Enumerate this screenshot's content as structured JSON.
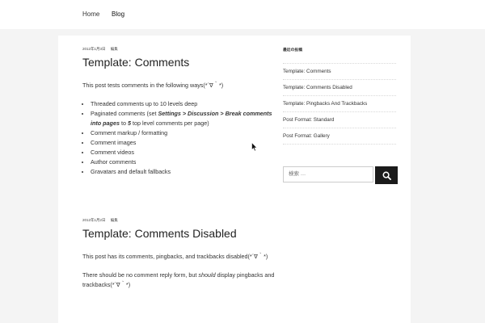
{
  "nav": {
    "home": "Home",
    "blog": "Blog"
  },
  "posts": [
    {
      "date": "2012年1月3日",
      "category": "編集",
      "title": "Template: Comments",
      "intro": "This post tests comments in the following ways(*´∇｀*)",
      "list": [
        "Threaded comments up to 10 levels deep",
        "Paginated comments",
        "Comment markup / formatting",
        "Comment images",
        "Comment videos",
        "Author comments",
        "Gravatars and default fallbacks"
      ],
      "paginated": {
        "pre": " (set ",
        "path": "Settings > Discussion > Break comments into pages",
        "to": " to ",
        "num": "5",
        "post": " top level comments per page)"
      }
    },
    {
      "date": "2012年1月2日",
      "category": "編集",
      "title": "Template: Comments Disabled",
      "p1": "This post has its comments, pingbacks, and trackbacks disabled(*´∇｀*)",
      "p2_pre": "There should be no comment reply form, but ",
      "p2_em": "should",
      "p2_post": " display pingbacks and trackbacks(*´∇｀*)"
    }
  ],
  "sidebar": {
    "recent_title": "最近の投稿",
    "recent": [
      "Template: Comments",
      "Template: Comments Disabled",
      "Template: Pingbacks And Trackbacks",
      "Post Format: Standard",
      "Post Format: Gallery"
    ],
    "search_placeholder": "検索 …"
  },
  "icons": {
    "search": "search-icon",
    "cursor": "mouse-cursor-icon"
  },
  "colors": {
    "search_button": "#1b1b1b",
    "background": "#f4f4f4"
  }
}
